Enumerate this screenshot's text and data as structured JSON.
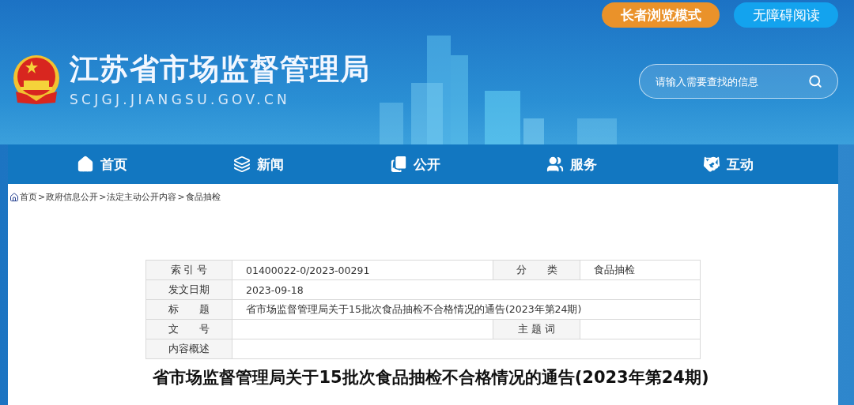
{
  "header": {
    "site_name": "江苏省市场监督管理局",
    "domain": "SCJGJ.JIANGSU.GOV.CN",
    "mode_buttons": [
      {
        "label": "长者浏览模式",
        "kind": "elder"
      },
      {
        "label": "无障碍阅读",
        "kind": "access"
      }
    ],
    "search": {
      "placeholder": "请输入需要查找的信息"
    }
  },
  "nav": [
    {
      "label": "首页"
    },
    {
      "label": "新闻"
    },
    {
      "label": "公开"
    },
    {
      "label": "服务"
    },
    {
      "label": "互动"
    }
  ],
  "breadcrumb": {
    "separator": ">",
    "items": [
      "首页",
      "政府信息公开",
      "法定主动公开内容",
      "食品抽检"
    ]
  },
  "metadata_table": {
    "rows": [
      {
        "kind": "split",
        "label": "索 引 号",
        "value": "01400022-0/2023-00291",
        "label_2": "分　　类",
        "value_2": "食品抽检"
      },
      {
        "kind": "full",
        "label": "发文日期",
        "value": "2023-09-18"
      },
      {
        "kind": "full",
        "label": "标　　题",
        "value": "省市场监督管理局关于15批次食品抽检不合格情况的通告(2023年第24期)"
      },
      {
        "kind": "split",
        "label": "文　　号",
        "label_2": "主 题 词"
      },
      {
        "kind": "full",
        "label": "内容概述"
      }
    ]
  },
  "article": {
    "title": "省市场监督管理局关于15批次食品抽检不合格情况的通告(2023年第24期)"
  }
}
